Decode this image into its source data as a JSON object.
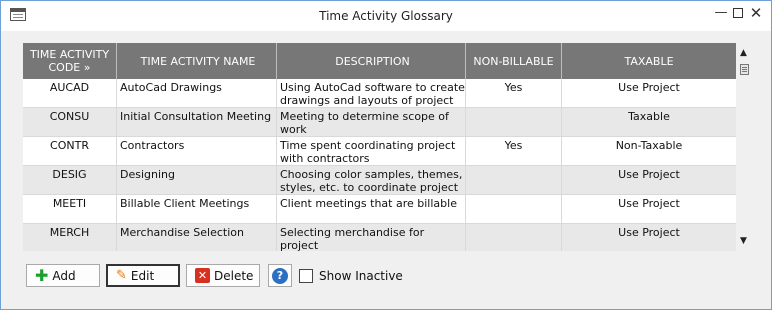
{
  "window": {
    "title": "Time Activity Glossary",
    "min_glyph": "—",
    "close_glyph": "✕"
  },
  "grid": {
    "columns": [
      "TIME ACTIVITY CODE »",
      "TIME ACTIVITY NAME",
      "DESCRIPTION",
      "NON-BILLABLE",
      "TAXABLE"
    ],
    "rows": [
      {
        "code": "AUCAD",
        "name": "AutoCad Drawings",
        "description": "Using AutoCad software to create drawings and layouts of project",
        "non_billable": "Yes",
        "taxable": "Use Project"
      },
      {
        "code": "CONSU",
        "name": "Initial Consultation Meeting",
        "description": "Meeting to determine scope of work",
        "non_billable": "",
        "taxable": "Taxable"
      },
      {
        "code": "CONTR",
        "name": "Contractors",
        "description": "Time spent coordinating project with contractors",
        "non_billable": "Yes",
        "taxable": "Non-Taxable"
      },
      {
        "code": "DESIG",
        "name": "Designing",
        "description": "Choosing color samples, themes, styles, etc. to coordinate project scope",
        "non_billable": "",
        "taxable": "Use Project"
      },
      {
        "code": "MEETI",
        "name": "Billable Client Meetings",
        "description": "Client meetings that are billable",
        "non_billable": "",
        "taxable": "Use Project"
      },
      {
        "code": "MERCH",
        "name": "Merchandise Selection",
        "description": "Selecting merchandise for project",
        "non_billable": "",
        "taxable": "Use Project"
      }
    ]
  },
  "toolbar": {
    "add_label": "Add",
    "edit_label": "Edit",
    "delete_label": "Delete",
    "help_glyph": "?",
    "show_inactive_label": "Show Inactive",
    "show_inactive_checked": false
  },
  "icons": {
    "add": "plus-icon",
    "edit": "pencil-icon",
    "delete": "delete-icon",
    "help": "help-icon"
  },
  "colors": {
    "header_bg": "#777777",
    "alt_row_bg": "#e8e8e8",
    "add_icon": "#18a02a",
    "delete_icon": "#d83020",
    "help_icon": "#2b6fc2"
  }
}
